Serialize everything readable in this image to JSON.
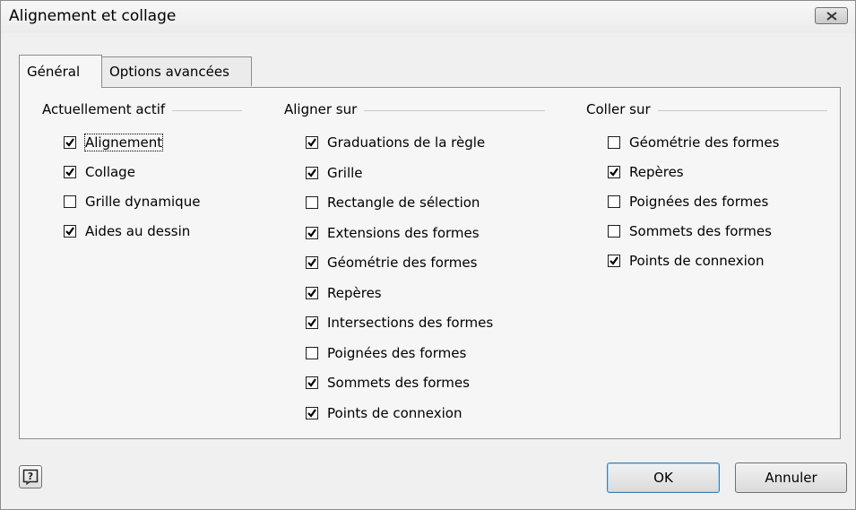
{
  "window": {
    "title": "Alignement et collage"
  },
  "tabs": [
    {
      "label": "Général",
      "active": true
    },
    {
      "label": "Options avancées",
      "active": false
    }
  ],
  "groups": {
    "actif": {
      "title": "Actuellement actif",
      "items": [
        {
          "label": "Alignement",
          "checked": true
        },
        {
          "label": "Collage",
          "checked": true
        },
        {
          "label": "Grille dynamique",
          "checked": false
        },
        {
          "label": "Aides au dessin",
          "checked": true
        }
      ]
    },
    "aligner": {
      "title": "Aligner sur",
      "items": [
        {
          "label": "Graduations de la règle",
          "checked": true
        },
        {
          "label": "Grille",
          "checked": true
        },
        {
          "label": "Rectangle de sélection",
          "checked": false
        },
        {
          "label": "Extensions des formes",
          "checked": true
        },
        {
          "label": "Géométrie des formes",
          "checked": true
        },
        {
          "label": "Repères",
          "checked": true
        },
        {
          "label": "Intersections des formes",
          "checked": true
        },
        {
          "label": "Poignées des formes",
          "checked": false
        },
        {
          "label": "Sommets des formes",
          "checked": true
        },
        {
          "label": "Points de connexion",
          "checked": true
        }
      ]
    },
    "coller": {
      "title": "Coller sur",
      "items": [
        {
          "label": "Géométrie des formes",
          "checked": false
        },
        {
          "label": "Repères",
          "checked": true
        },
        {
          "label": "Poignées des formes",
          "checked": false
        },
        {
          "label": "Sommets des formes",
          "checked": false
        },
        {
          "label": "Points de connexion",
          "checked": true
        }
      ]
    }
  },
  "buttons": {
    "ok": "OK",
    "cancel": "Annuler",
    "help": "?"
  }
}
